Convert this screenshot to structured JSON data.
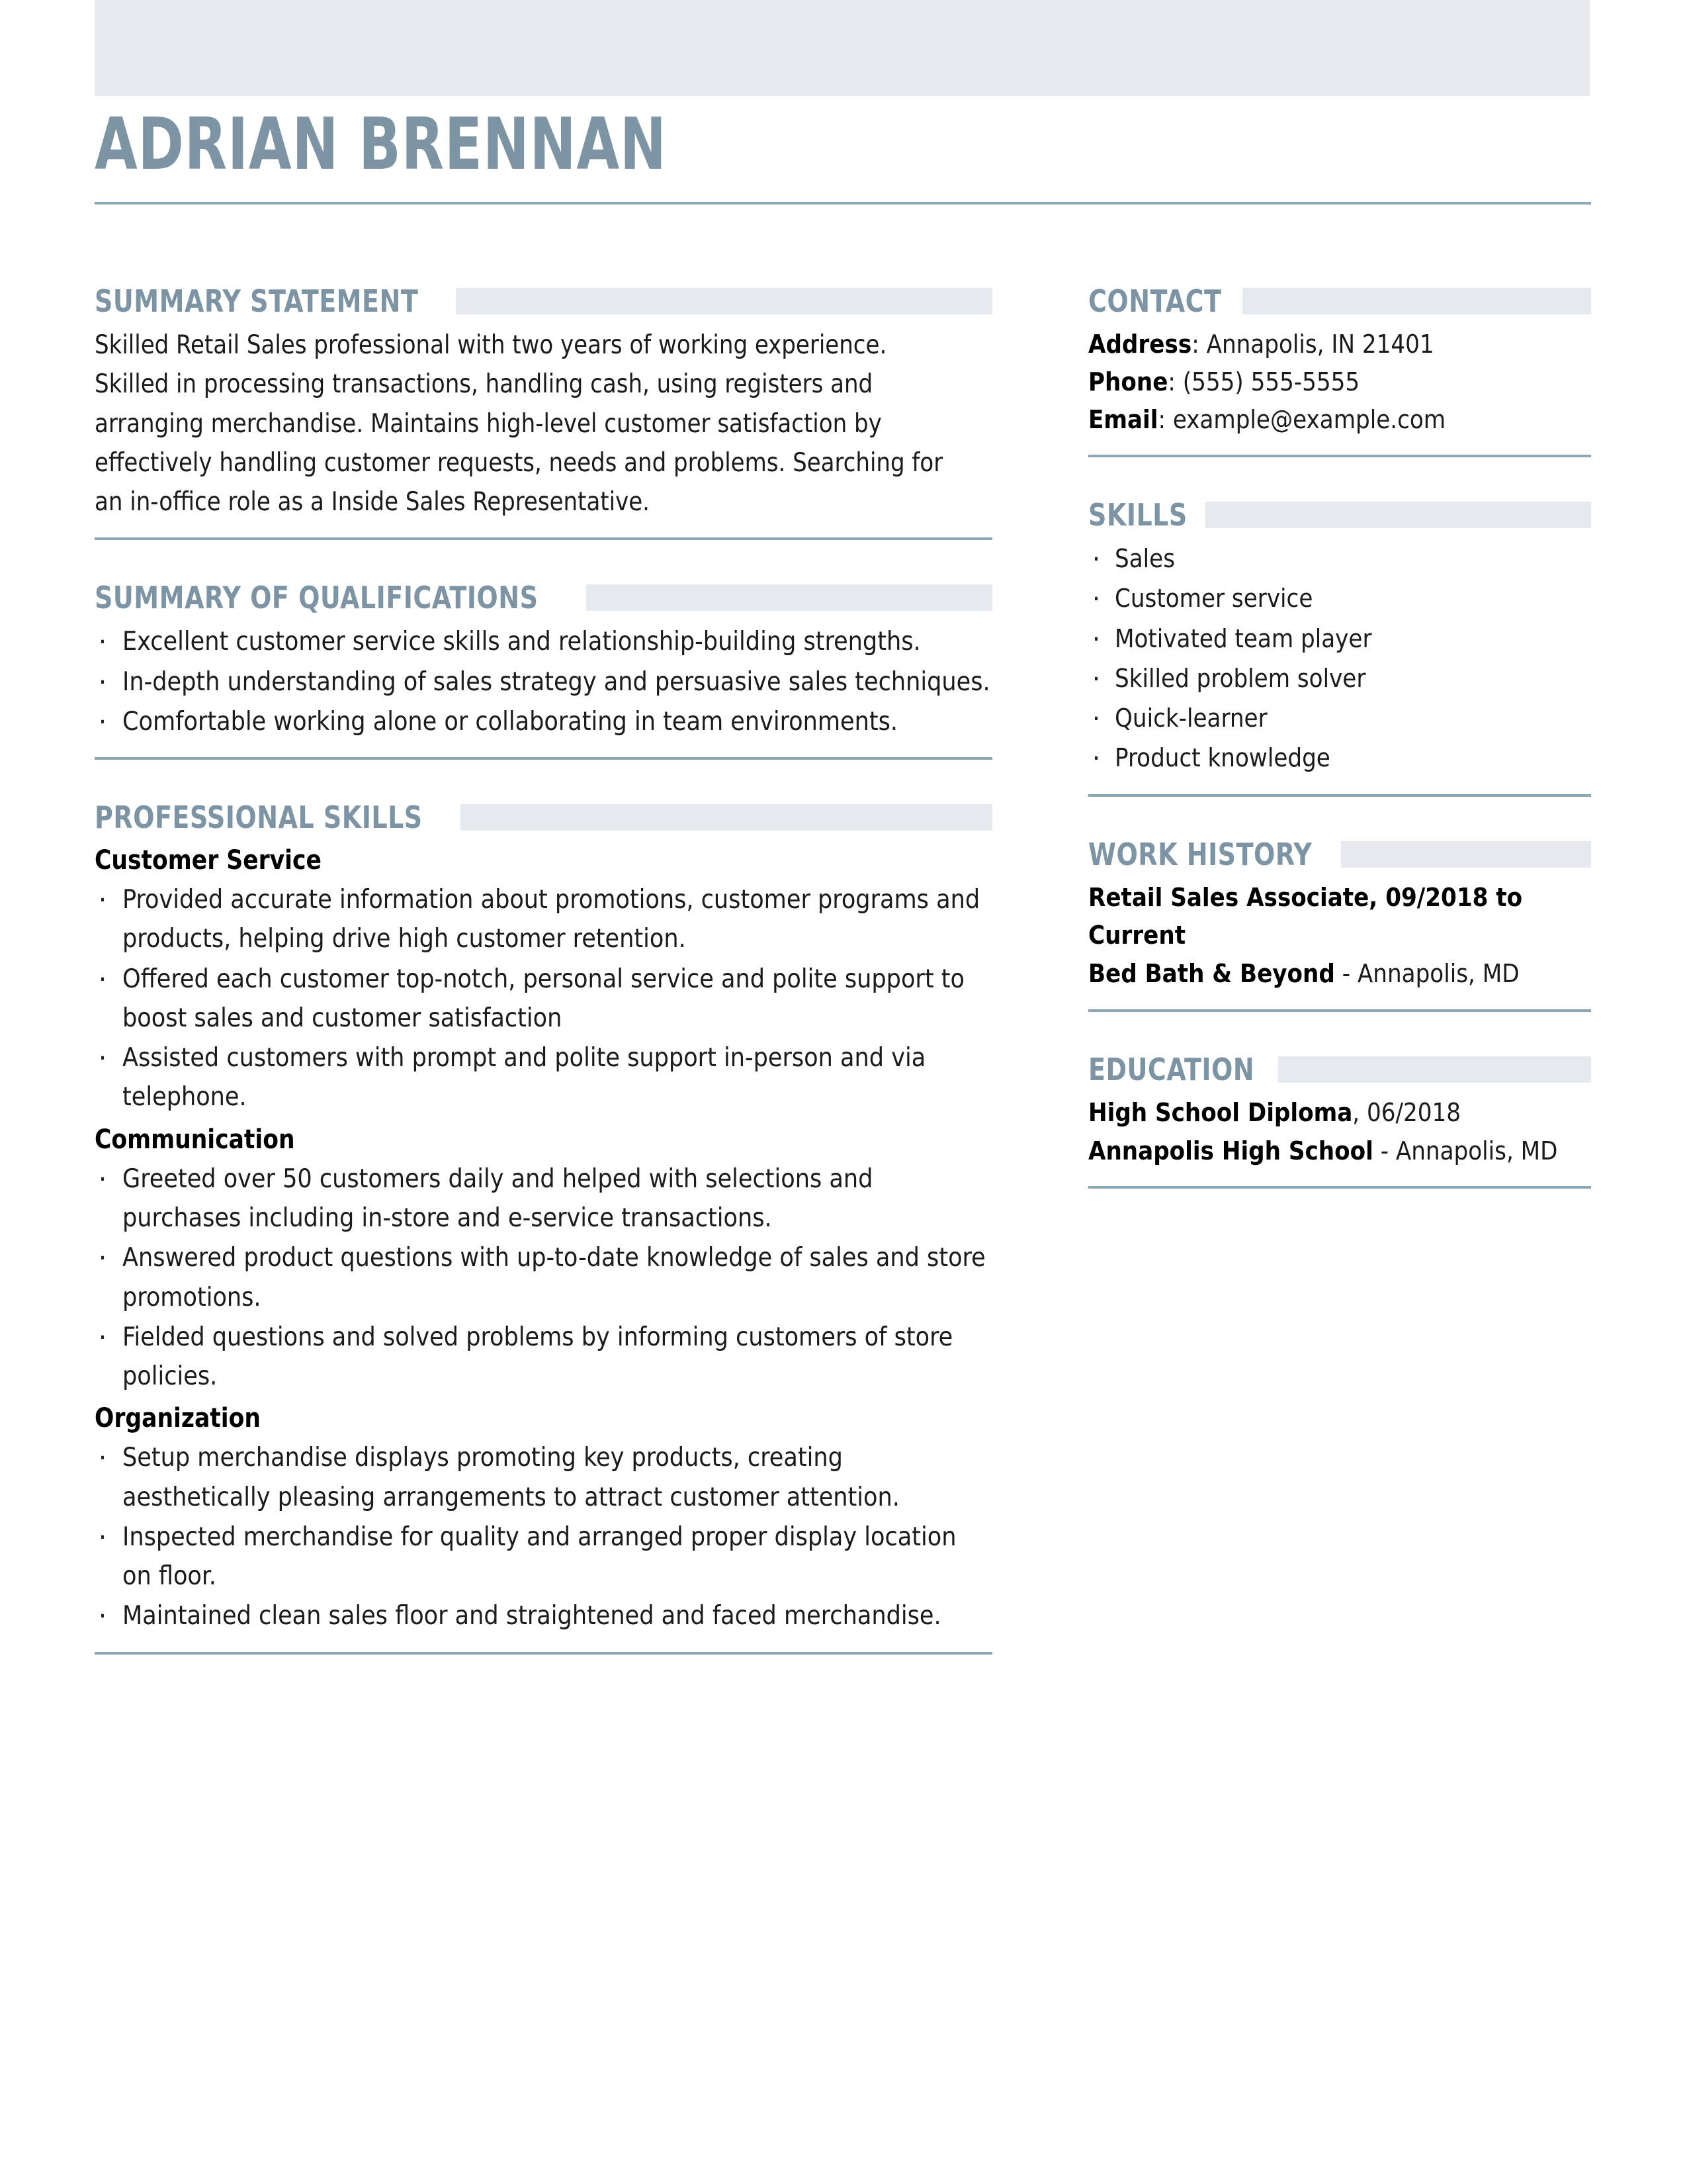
{
  "colors": {
    "accent": "#7c94a4",
    "rule": "#8ea7b6",
    "band": "#e6eaee",
    "text": "#1b1b1b"
  },
  "header": {
    "name": "ADRIAN BRENNAN"
  },
  "left": {
    "summary": {
      "title": "SUMMARY STATEMENT",
      "text": "Skilled Retail Sales professional with two years of working experience. Skilled in processing transactions, handling cash, using registers and arranging merchandise. Maintains high-level customer satisfaction by effectively handling customer requests, needs and problems. Searching for an in-office role as a Inside Sales Representative."
    },
    "qualifications": {
      "title": "SUMMARY OF QUALIFICATIONS",
      "items": [
        "Excellent customer service skills and relationship-building strengths.",
        "In-depth understanding of sales strategy and persuasive sales techniques.",
        "Comfortable working alone or collaborating in team environments."
      ]
    },
    "professional_skills": {
      "title": "PROFESSIONAL SKILLS",
      "groups": [
        {
          "heading": "Customer Service",
          "items": [
            "Provided accurate information about promotions, customer programs and products, helping drive high customer retention.",
            "Offered each customer top-notch, personal service and polite support to boost sales and customer satisfaction",
            "Assisted customers with prompt and polite support in-person and via telephone."
          ]
        },
        {
          "heading": "Communication",
          "items": [
            "Greeted over 50 customers daily and helped with selections and purchases including in-store and e-service transactions.",
            "Answered product questions with up-to-date knowledge of sales and store promotions.",
            "Fielded questions and solved problems by informing customers of store policies."
          ]
        },
        {
          "heading": "Organization",
          "items": [
            "Setup merchandise displays promoting key products, creating aesthetically pleasing arrangements to attract customer attention.",
            "Inspected merchandise for quality and arranged proper display location on floor.",
            "Maintained clean sales floor and straightened and faced merchandise."
          ]
        }
      ]
    }
  },
  "right": {
    "contact": {
      "title": "CONTACT",
      "address_label": "Address",
      "address_value": ": Annapolis, IN 21401",
      "phone_label": "Phone",
      "phone_value": ": (555) 555-5555",
      "email_label": "Email",
      "email_value": ": example@example.com"
    },
    "skills": {
      "title": "SKILLS",
      "items": [
        "Sales",
        "Customer service",
        "Motivated team player",
        "Skilled problem solver",
        "Quick-learner",
        "Product knowledge"
      ]
    },
    "work_history": {
      "title": "WORK HISTORY",
      "role_line": "Retail Sales Associate, 09/2018 to Current",
      "company": "Bed Bath & Beyond",
      "company_location": " - Annapolis, MD"
    },
    "education": {
      "title": "EDUCATION",
      "degree": "High School Diploma",
      "degree_date": ", 06/2018",
      "school": "Annapolis High School",
      "school_location": " - Annapolis, MD"
    }
  }
}
